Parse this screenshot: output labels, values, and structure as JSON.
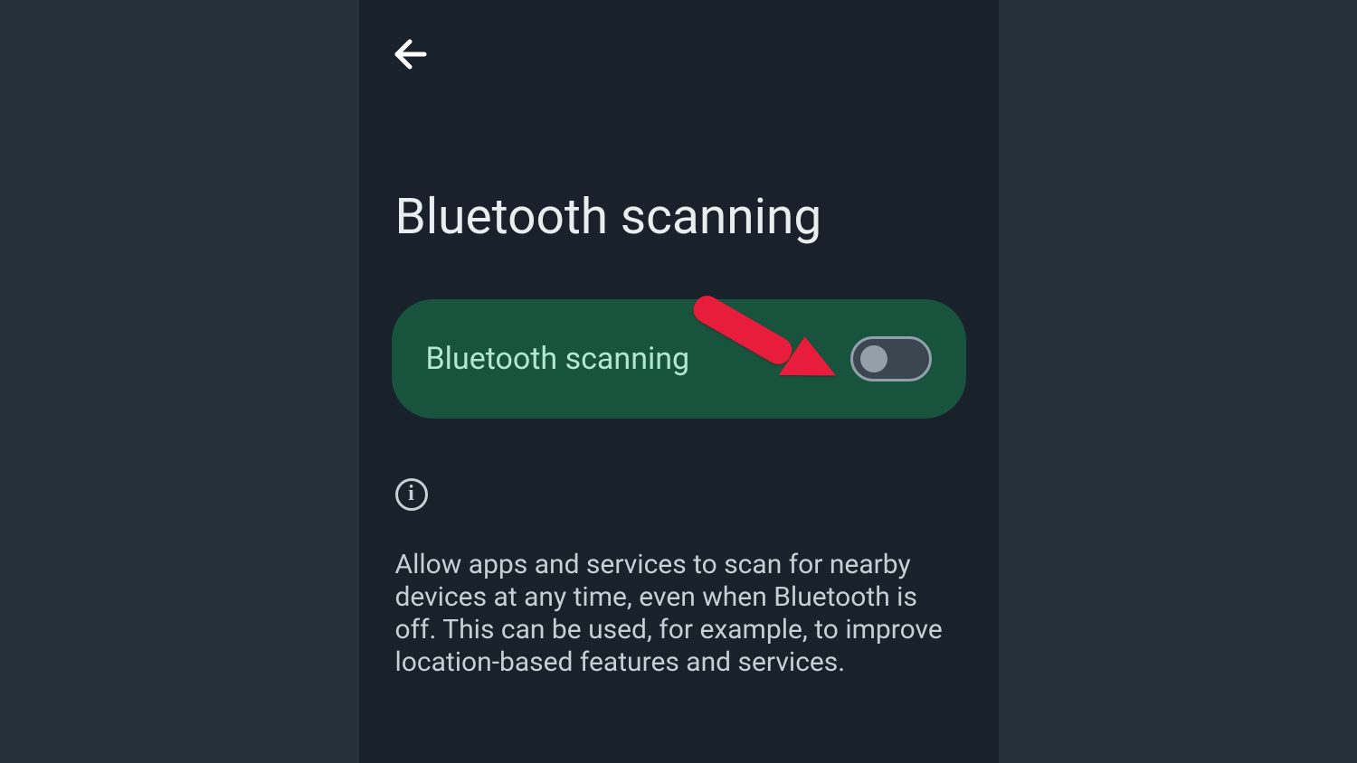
{
  "header": {
    "page_title": "Bluetooth scanning"
  },
  "toggle": {
    "label": "Bluetooth scanning",
    "state": "off"
  },
  "info": {
    "icon_glyph": "i",
    "description": "Allow apps and services to scan for nearby devices at any time, even when Bluetooth is off. This can be used, for example, to improve location-based features and services."
  },
  "colors": {
    "panel_bg": "#19212a",
    "outer_bg": "#25303a",
    "card_bg": "#17533d",
    "accent_text": "#b4e7d2",
    "body_text": "#c5d0d4",
    "title_text": "#e7eef0"
  }
}
